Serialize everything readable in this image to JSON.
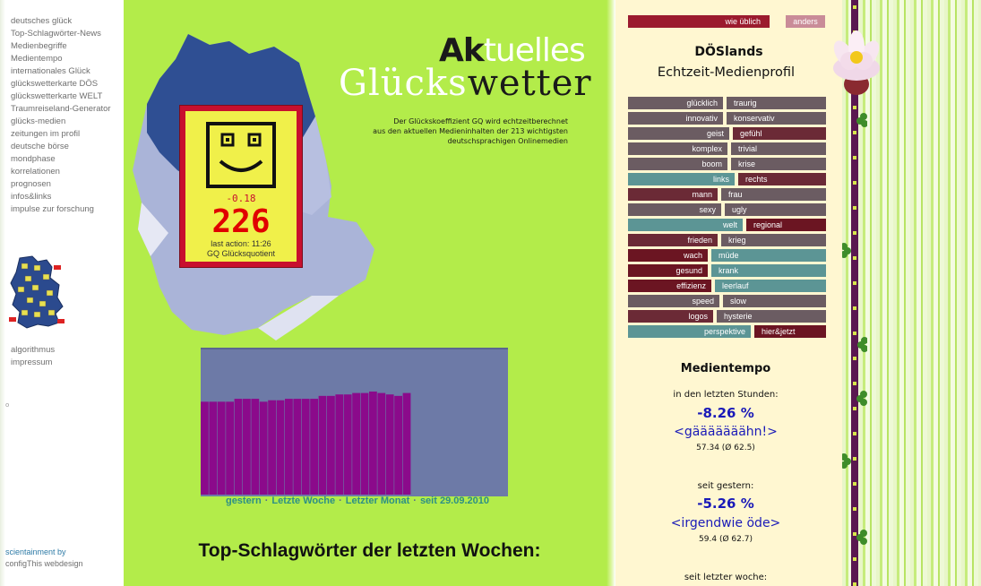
{
  "sidebar": {
    "nav": [
      "deutsches glück",
      "Top-Schlagwörter-News",
      "Medienbegriffe",
      "Medientempo",
      "internationales Glück",
      "glückswetterkarte DÖS",
      "glückswetterkarte WELT",
      "Traumreiseland-Generator",
      "glücks-medien",
      "zeitungen im profil",
      "deutsche börse",
      "mondphase",
      "korrelationen",
      "prognosen",
      "infos&links",
      "impulse zur forschung"
    ],
    "nav2": [
      "algorithmus",
      "impressum"
    ],
    "credit1": "scientainment by",
    "credit2": "configThis webdesign",
    "tiny": "o"
  },
  "header": {
    "logo_ak": "Ak",
    "logo_rest": "tuelles",
    "logo_gl_light": "Glücks",
    "logo_gl_dark": "wetter",
    "desc_line1": "Der Glückskoeffizient GQ wird echtzeitberechnet",
    "desc_line2": "aus den aktuellen Medieninhalten der 213 wichtigsten",
    "desc_line3": "deutschsprachigen Onlinemedien"
  },
  "gq": {
    "delta": "-0.18",
    "value": "226",
    "last_action": "last action: 11:26",
    "label": "GQ Glücksquotient"
  },
  "chart_data": {
    "type": "bar",
    "ylim": [
      0,
      100
    ],
    "values": [
      64,
      64,
      64,
      64,
      66,
      66,
      66,
      64,
      65,
      65,
      66,
      66,
      66,
      66,
      68,
      68,
      69,
      69,
      70,
      70,
      71,
      70,
      69,
      68,
      70
    ]
  },
  "chart_links": [
    "gestern",
    "Letzte Woche",
    "Letzter Monat",
    "seit 29.09.2010"
  ],
  "top_heading": "Top-Schlagwörter der letzten Wochen:",
  "right": {
    "btn_usual": "wie üblich",
    "btn_other": "anders",
    "title1": "DÖSlands",
    "title2": "Echtzeit-Medienprofil",
    "pairs": [
      {
        "l": "glücklich",
        "r": "traurig",
        "split": 0.49,
        "lc": "#6b5c62",
        "rc": "#6b5c62"
      },
      {
        "l": "innovativ",
        "r": "konservativ",
        "split": 0.49,
        "lc": "#6b5c62",
        "rc": "#6b5c62"
      },
      {
        "l": "geist",
        "r": "gefühl",
        "split": 0.52,
        "lc": "#6b5c62",
        "rc": "#6b2a36"
      },
      {
        "l": "komplex",
        "r": "trivial",
        "split": 0.51,
        "lc": "#6b5c62",
        "rc": "#6b5c62"
      },
      {
        "l": "boom",
        "r": "krise",
        "split": 0.51,
        "lc": "#6b5c62",
        "rc": "#6b5c62"
      },
      {
        "l": "links",
        "r": "rechts",
        "split": 0.55,
        "lc": "#5c9595",
        "rc": "#6b2a36"
      },
      {
        "l": "mann",
        "r": "frau",
        "split": 0.46,
        "lc": "#6b2a36",
        "rc": "#6b5c62"
      },
      {
        "l": "sexy",
        "r": "ugly",
        "split": 0.48,
        "lc": "#6b5c62",
        "rc": "#6b5c62"
      },
      {
        "l": "welt",
        "r": "regional",
        "split": 0.59,
        "lc": "#5c9595",
        "rc": "#6b1522"
      },
      {
        "l": "frieden",
        "r": "krieg",
        "split": 0.46,
        "lc": "#6b2a36",
        "rc": "#6b5c62"
      },
      {
        "l": "wach",
        "r": "müde",
        "split": 0.41,
        "lc": "#6b1522",
        "rc": "#5c9595"
      },
      {
        "l": "gesund",
        "r": "krank",
        "split": 0.41,
        "lc": "#6b1522",
        "rc": "#5c9595"
      },
      {
        "l": "effizienz",
        "r": "leerlauf",
        "split": 0.43,
        "lc": "#6b1522",
        "rc": "#5c9595"
      },
      {
        "l": "speed",
        "r": "slow",
        "split": 0.47,
        "lc": "#6b5c62",
        "rc": "#6b5c62"
      },
      {
        "l": "logos",
        "r": "hysterie",
        "split": 0.44,
        "lc": "#6b2a36",
        "rc": "#6b5c62"
      },
      {
        "l": "perspektive",
        "r": "hier&jetzt",
        "split": 0.63,
        "lc": "#5c9595",
        "rc": "#6b1522"
      }
    ],
    "tempo": {
      "title": "Medientempo",
      "s1_label": "in den letzten Stunden:",
      "s1_pct": "-8.26 %",
      "s1_word": "<gääääääähn!>",
      "s1_val": "57.34 (Ø 62.5)",
      "s2_label": "seit gestern:",
      "s2_pct": "-5.26 %",
      "s2_word": "<irgendwie öde>",
      "s2_val": "59.4 (Ø 62.7)",
      "s3_label": "seit letzter woche:"
    }
  },
  "colors": {
    "green": "#b3ec4a",
    "red": "#c8102e",
    "bar": "#8b0a8b",
    "chart_bg": "#6d7aa7"
  }
}
